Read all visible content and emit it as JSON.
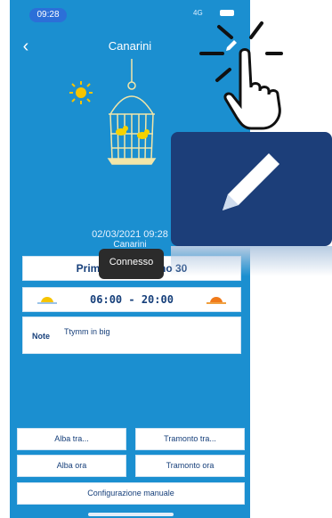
{
  "status": {
    "time": "09:28",
    "network": "4G"
  },
  "nav": {
    "title": "Canarini"
  },
  "info": {
    "datetime": "02/03/2021 09:28",
    "device": "Canarini"
  },
  "season": {
    "label": "Primavera - Giorno 30"
  },
  "times": {
    "range": "06:00 - 20:00"
  },
  "notes": {
    "label": "Note",
    "value": "Ttymm in big"
  },
  "toast": {
    "message": "Connesso"
  },
  "buttons": {
    "alba_tra": "Alba tra...",
    "tramonto_tra": "Tramonto tra...",
    "alba_ora": "Alba ora",
    "tramonto_ora": "Tramonto ora",
    "config": "Configurazione manuale"
  },
  "icons": [
    "back-icon",
    "pencil-icon",
    "sun-icon",
    "birdcage-icon",
    "sunrise-icon",
    "sunset-icon",
    "battery-icon",
    "hand-pointer-icon"
  ],
  "colors": {
    "app_bg": "#1b8fd0",
    "zoom_bg": "#1c3e79",
    "text_dark": "#163f7a",
    "sun": "#f6c400"
  }
}
